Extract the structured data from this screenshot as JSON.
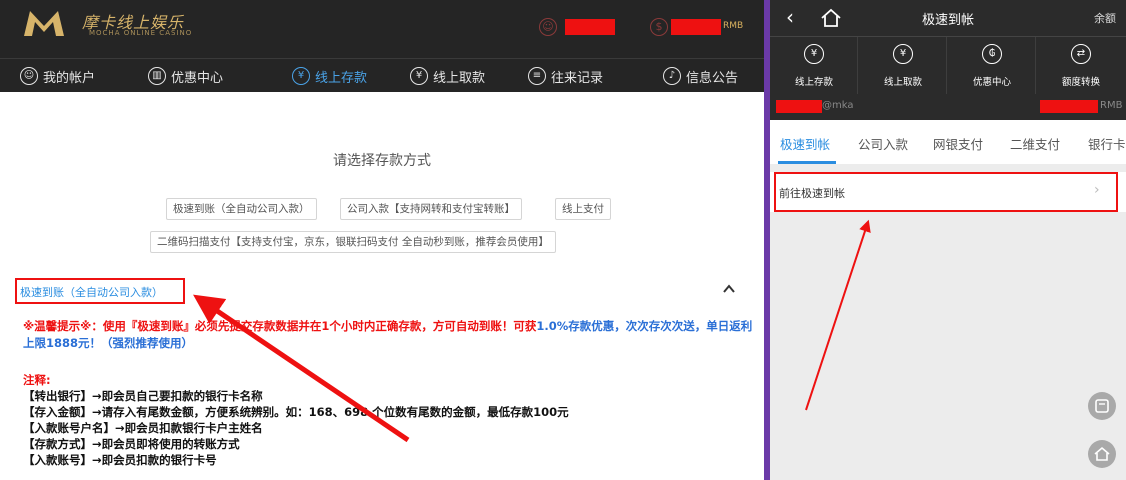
{
  "desktop": {
    "logo": {
      "cn": "摩卡线上娱乐",
      "en": "MOCHA ONLINE CASINO"
    },
    "header": {
      "currency": "RMB"
    },
    "nav": [
      {
        "label": "我的帐户",
        "icon": "user-icon"
      },
      {
        "label": "优惠中心",
        "icon": "gift-icon"
      },
      {
        "label": "线上存款",
        "icon": "deposit-icon",
        "active": true
      },
      {
        "label": "线上取款",
        "icon": "withdraw-icon"
      },
      {
        "label": "往来记录",
        "icon": "record-icon"
      },
      {
        "label": "信息公告",
        "icon": "bell-icon"
      }
    ],
    "choose_title": "请选择存款方式",
    "options": [
      "极速到账（全自动公司入款）",
      "公司入款【支持网转和支付宝转账】",
      "线上支付",
      "二维码扫描支付【支持支付宝，京东，银联扫码支付 全自动秒到账，推荐会员使用】"
    ],
    "section_title": "极速到账（全自动公司入款）",
    "tip": {
      "part1": "※温馨提示※：使用『极速到账』必须先提交存款数据并在1个小时内正确存款，方可自动到账！可获",
      "percent": "1.0%",
      "part2": "存款优惠，次次存次次送，单日返利上限1888元！（强烈推荐使用）"
    },
    "notes_title": "注释:",
    "notes": [
      "【转出银行】→即会员自己要扣款的银行卡名称",
      "【存入金额】→请存入有尾数金额，方便系统辨别。如：168、698 个位数有尾数的金额，最低存款100元",
      "【入款账号户名】→即会员扣款银行卡户主姓名",
      "【存款方式】→即会员即将使用的转账方式",
      "【入款账号】→即会员扣款的银行卡号"
    ]
  },
  "mobile": {
    "title": "极速到帐",
    "balance_label": "余额",
    "quick": [
      {
        "label": "线上存款",
        "icon": "deposit-icon"
      },
      {
        "label": "线上取款",
        "icon": "withdraw-icon"
      },
      {
        "label": "优惠中心",
        "icon": "promo-icon"
      },
      {
        "label": "额度转换",
        "icon": "transfer-icon"
      }
    ],
    "user_suffix": "@mka",
    "currency": "RMB",
    "tabs": [
      "极速到帐",
      "公司入款",
      "网银支付",
      "二维支付",
      "银行卡"
    ],
    "row_label": "前往极速到帐"
  },
  "colors": {
    "accent": "#2a8de0",
    "highlight": "#e11111",
    "dark": "#252525",
    "gold": "#d7b46a"
  }
}
